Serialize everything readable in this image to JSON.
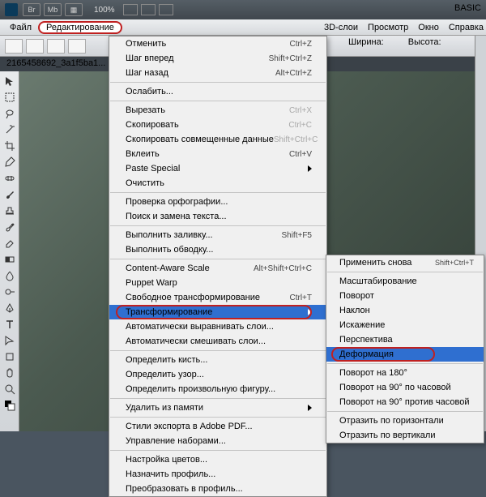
{
  "appbar": {
    "zoom": "100%",
    "basic": "BASIC"
  },
  "menubar": {
    "file": "Файл",
    "edit": "Редактирование"
  },
  "topmenu2": {
    "layers3d": "3D-слои",
    "view": "Просмотр",
    "window": "Окно",
    "help": "Справка"
  },
  "optright": {
    "w": "Ширина:",
    "h": "Высота:"
  },
  "tabbar": {
    "doc": "2165458692_3a1f5ba1..."
  },
  "edit_menu": {
    "undo": "Отменить",
    "undo_sc": "Ctrl+Z",
    "step_fwd": "Шаг вперед",
    "step_fwd_sc": "Shift+Ctrl+Z",
    "step_back": "Шаг назад",
    "step_back_sc": "Alt+Ctrl+Z",
    "fade": "Ослабить...",
    "cut": "Вырезать",
    "cut_sc": "Ctrl+X",
    "copy": "Скопировать",
    "copy_sc": "Ctrl+C",
    "copy_merged": "Скопировать совмещенные данные",
    "copy_merged_sc": "Shift+Ctrl+C",
    "paste": "Вклеить",
    "paste_sc": "Ctrl+V",
    "paste_special": "Paste Special",
    "clear": "Очистить",
    "spell": "Проверка орфографии...",
    "find": "Поиск и замена текста...",
    "fill": "Выполнить заливку...",
    "fill_sc": "Shift+F5",
    "stroke": "Выполнить обводку...",
    "cas": "Content-Aware Scale",
    "cas_sc": "Alt+Shift+Ctrl+C",
    "puppet": "Puppet Warp",
    "free_t": "Свободное трансформирование",
    "free_t_sc": "Ctrl+T",
    "transform": "Трансформирование",
    "auto_align": "Автоматически выравнивать слои...",
    "auto_blend": "Автоматически смешивать слои...",
    "def_brush": "Определить кисть...",
    "def_pattern": "Определить узор...",
    "def_shape": "Определить произвольную фигуру...",
    "purge": "Удалить из памяти",
    "pdf_styles": "Стили экспорта в Adobe PDF...",
    "presets": "Управление наборами...",
    "color_set": "Настройка цветов...",
    "assign_profile": "Назначить профиль...",
    "convert_profile": "Преобразовать в профиль..."
  },
  "transform_menu": {
    "again": "Применить снова",
    "again_sc": "Shift+Ctrl+T",
    "scale": "Масштабирование",
    "rotate": "Поворот",
    "skew": "Наклон",
    "distort": "Искажение",
    "perspective": "Перспектива",
    "warp": "Деформация",
    "r180": "Поворот на 180°",
    "r90cw": "Поворот на 90° по часовой",
    "r90ccw": "Поворот на 90° против часовой",
    "flip_h": "Отразить по горизонтали",
    "flip_v": "Отразить по вертикали"
  }
}
